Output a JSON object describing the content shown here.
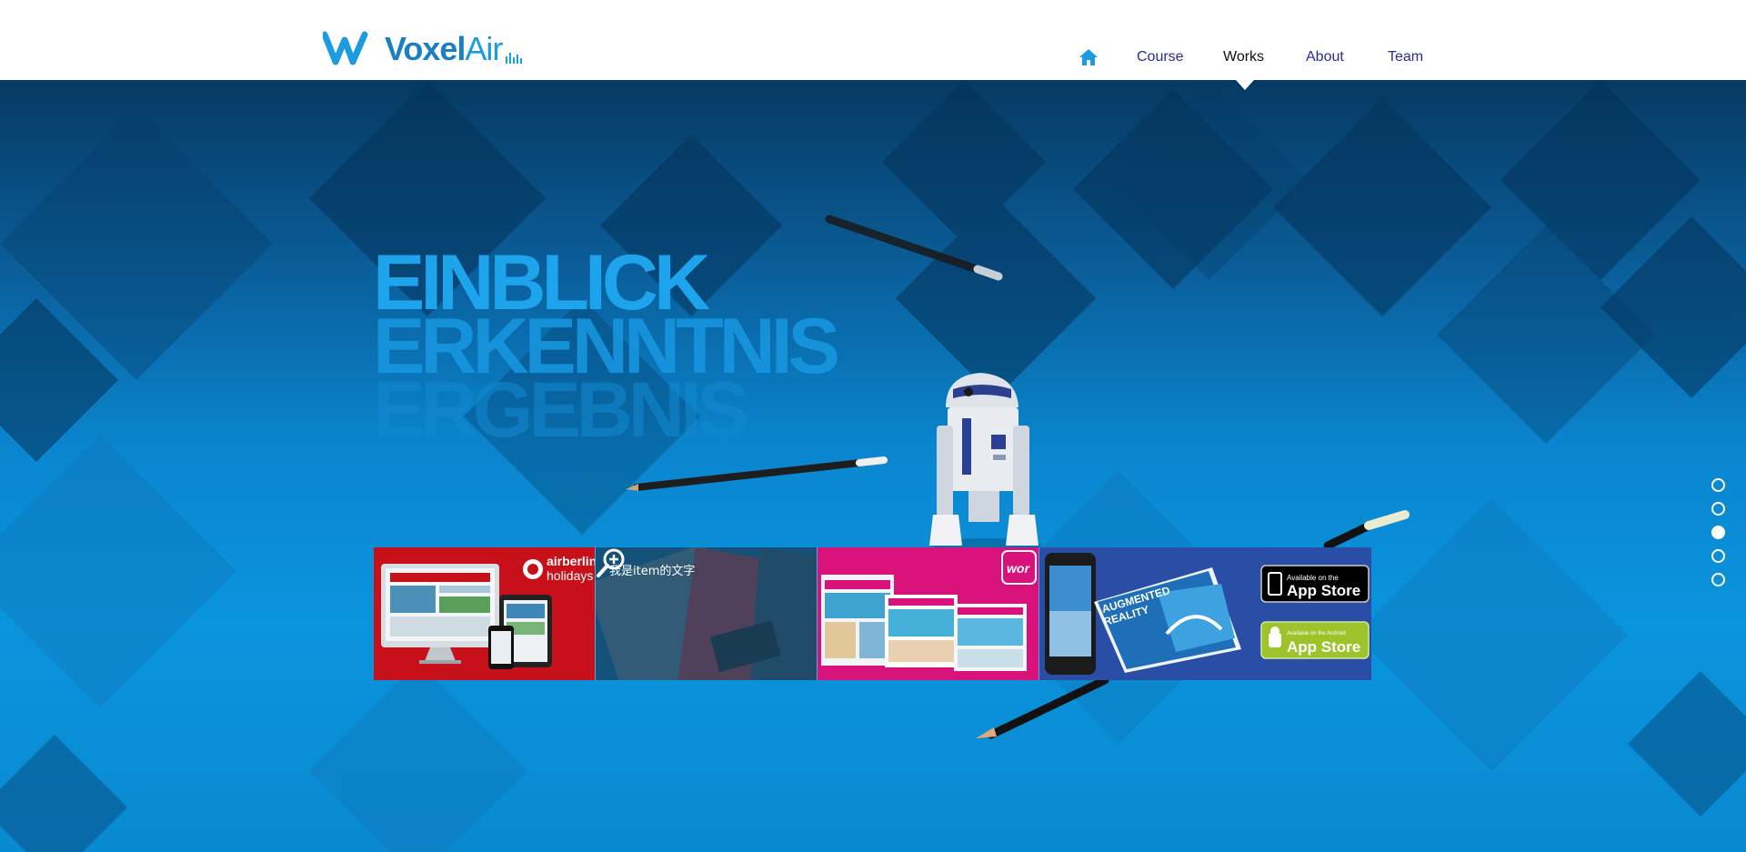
{
  "brand": {
    "name_part1": "Voxel",
    "name_part2": "Air",
    "primary_color": "#1b7fc4",
    "accent_color": "#1b9be0"
  },
  "nav": {
    "home_icon": "home-icon",
    "items": [
      {
        "label": "Course",
        "active": false
      },
      {
        "label": "Works",
        "active": true
      },
      {
        "label": "About",
        "active": false
      },
      {
        "label": "Team",
        "active": false
      }
    ]
  },
  "hero": {
    "headline": [
      "EINBLICK",
      "ERKENNTNIS",
      "ERGEBNIS"
    ],
    "background_color": "#0a86cf"
  },
  "works": [
    {
      "id": "airberlin",
      "brand_text": [
        "airberlin",
        "holidays"
      ],
      "background": "#c8101a"
    },
    {
      "id": "magazine",
      "caption": "我是item的文字",
      "hover_icon": "zoom-in-icon",
      "background": "#1e5a80"
    },
    {
      "id": "pink-web",
      "brand_text": "wor",
      "background": "#d8127a"
    },
    {
      "id": "augmented-reality",
      "book_title": [
        "AUGMENTED",
        "REALITY"
      ],
      "badges": [
        {
          "small": "Available on the",
          "big": "App Store"
        },
        {
          "small": "Available on the Android",
          "big": "App Store"
        }
      ],
      "background": "#2a4da6"
    }
  ],
  "pager": {
    "count": 5,
    "active_index": 2
  }
}
